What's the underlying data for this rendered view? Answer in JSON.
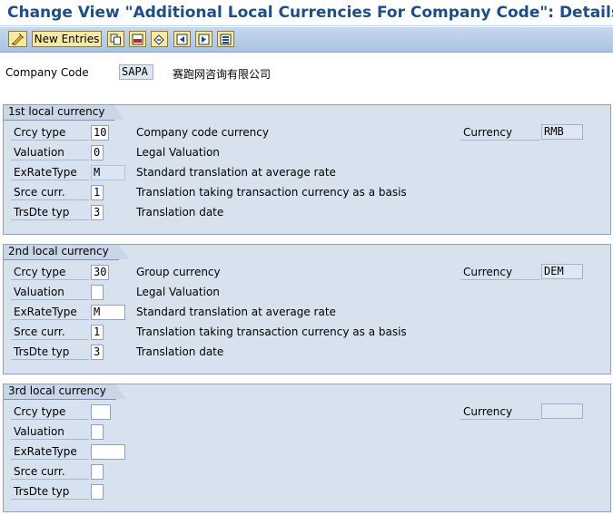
{
  "window": {
    "title": "Change View \"Additional Local Currencies For Company Code\": Details"
  },
  "toolbar": {
    "new_entries_label": "New Entries",
    "icons": [
      "change-display-icon",
      "copy-icon",
      "delete-icon",
      "undo-icon",
      "first-entry-icon",
      "previous-entry-icon",
      "next-entry-icon",
      "last-entry-icon"
    ]
  },
  "header": {
    "company_code_label": "Company Code",
    "company_code_value": "SAPA",
    "company_name": "赛跑网咨询有限公司"
  },
  "labels": {
    "crcy_type": "Crcy type",
    "valuation": "Valuation",
    "exrate_type": "ExRateType",
    "srce_curr": "Srce curr.",
    "trsdte_typ": "TrsDte typ",
    "currency": "Currency"
  },
  "groups": [
    {
      "title": "1st local currency",
      "crcy_type": "10",
      "crcy_type_desc": "Company code currency",
      "valuation": "0",
      "valuation_desc": "Legal Valuation",
      "exrate_type": "M",
      "exrate_type_desc": "Standard translation at average rate",
      "srce_curr": "1",
      "srce_curr_desc": "Translation taking transaction currency as a basis",
      "trsdte_typ": "3",
      "trsdte_typ_desc": "Translation date",
      "currency": "RMB"
    },
    {
      "title": "2nd local currency",
      "crcy_type": "30",
      "crcy_type_desc": "Group currency",
      "valuation": "",
      "valuation_desc": "Legal Valuation",
      "exrate_type": "M",
      "exrate_type_desc": "Standard translation at average rate",
      "srce_curr": "1",
      "srce_curr_desc": "Translation taking transaction currency as a basis",
      "trsdte_typ": "3",
      "trsdte_typ_desc": "Translation date",
      "currency": "DEM"
    },
    {
      "title": "3rd local currency",
      "crcy_type": "",
      "crcy_type_desc": "",
      "valuation": "",
      "valuation_desc": "",
      "exrate_type": "",
      "exrate_type_desc": "",
      "srce_curr": "",
      "srce_curr_desc": "",
      "trsdte_typ": "",
      "trsdte_typ_desc": "",
      "currency": ""
    }
  ]
}
